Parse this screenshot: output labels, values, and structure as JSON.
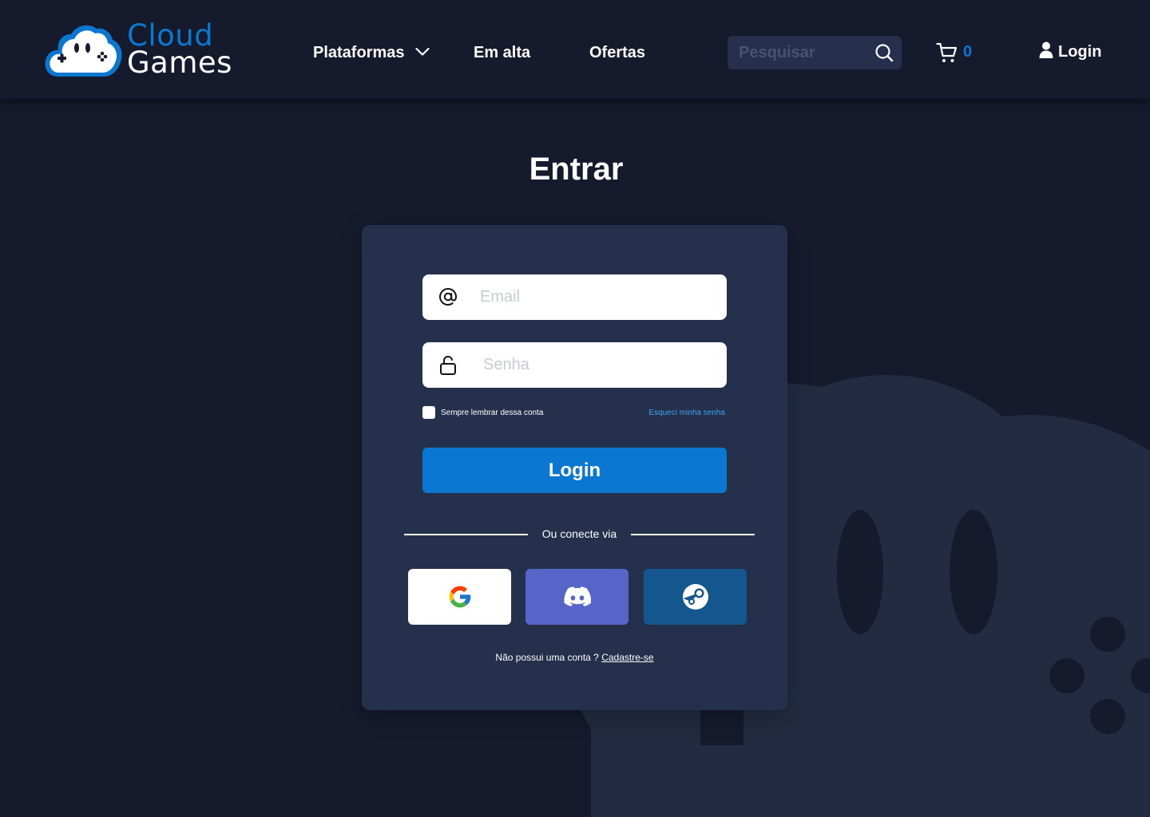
{
  "brand": {
    "line1": "Cloud",
    "line2": "Games",
    "accent": "#0a78d1"
  },
  "nav": {
    "plataformas": "Plataformas",
    "em_alta": "Em alta",
    "ofertas": "Ofertas"
  },
  "search": {
    "placeholder": "Pesquisar",
    "icon": "search-icon"
  },
  "cart": {
    "count": "0",
    "icon": "cart-icon"
  },
  "header_login": {
    "label": "Login",
    "icon": "user-icon"
  },
  "page": {
    "title": "Entrar"
  },
  "form": {
    "email_placeholder": "Email",
    "password_placeholder": "Senha",
    "remember_label": "Sempre lembrar dessa conta",
    "forgot_label": "Esqueci minha senha",
    "login_label": "Login",
    "divider_text": "Ou conecte via",
    "social": [
      {
        "name": "Google",
        "icon": "google-icon",
        "color": "#ffffff"
      },
      {
        "name": "Discord",
        "icon": "discord-icon",
        "color": "#5865c8"
      },
      {
        "name": "Steam",
        "icon": "steam-icon",
        "color": "#14578f"
      }
    ],
    "signup_prompt": "Não possui uma conta ?",
    "signup_link": "Cadastre-se"
  },
  "colors": {
    "background": "#151b2d",
    "card": "#25304c",
    "primary": "#0a78d1",
    "link": "#3fa0f0"
  }
}
